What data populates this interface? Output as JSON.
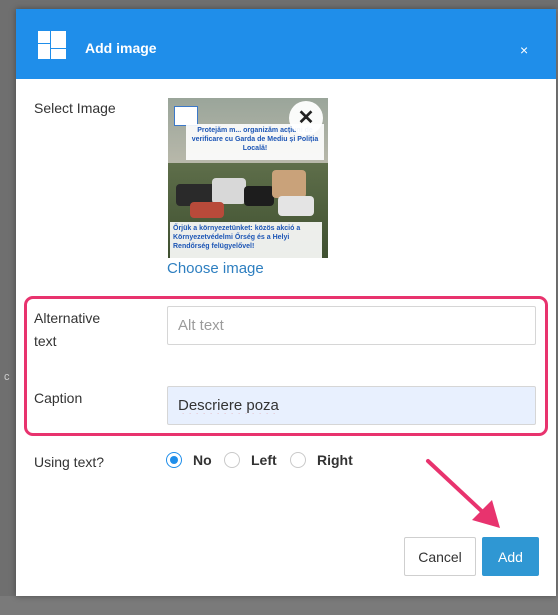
{
  "dialog": {
    "title": "Add image",
    "close_glyph": "×",
    "select_image_label": "Select Image",
    "image_overlay_top": "Protejăm m... organizăm acțiuni de verificare cu Garda de Mediu și Poliția Locală!",
    "image_overlay_bottom": "Őrjük a környezetünket: közös akció a Környezetvédelmi Őrség és a Helyi Rendőrség felügyelővel!",
    "remove_image_glyph": "✕",
    "choose_image_link": "Choose image",
    "alt_label": "Alternative text",
    "alt_placeholder": "Alt text",
    "alt_value": "",
    "caption_label": "Caption",
    "caption_value": "Descriere poza",
    "using_text_label": "Using text?",
    "radio_options": [
      "No",
      "Left",
      "Right"
    ],
    "radio_selected": "No",
    "cancel_label": "Cancel",
    "add_label": "Add"
  },
  "background": {
    "partial_text": "c"
  },
  "colors": {
    "header": "#1f8eea",
    "add_button": "#2f97d3",
    "annotation": "#e8336e",
    "link": "#2e7fc0"
  },
  "icons": {
    "logo": "grid-logo-icon",
    "close": "close-icon",
    "remove": "remove-image-icon",
    "annotation_arrow": "arrow-annotation-icon"
  }
}
